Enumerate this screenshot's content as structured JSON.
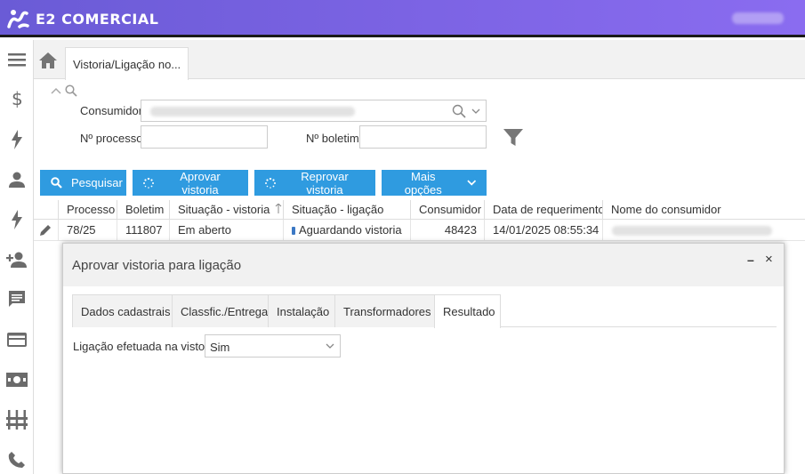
{
  "app": {
    "brand": "E2 COMERCIAL",
    "accent": "#7b63e3"
  },
  "sidebar": {
    "icons": [
      "menu-icon",
      "dollar-icon",
      "bolt-icon",
      "person-icon",
      "bolt-icon-2",
      "person-add-icon",
      "comment-icon",
      "card-icon",
      "money-icon",
      "meter-icon",
      "phone-icon"
    ]
  },
  "tabs": {
    "active": "Vistoria/Ligação no..."
  },
  "filters": {
    "consumidor_label": "Consumidor",
    "processo_label": "Nº processo",
    "boletim_label": "Nº boletim"
  },
  "toolbar": {
    "pesquisar": "Pesquisar",
    "aprovar": "Aprovar vistoria",
    "reprovar": "Reprovar vistoria",
    "mais": "Mais opções"
  },
  "grid": {
    "columns": [
      "Processo",
      "Boletim",
      "Situação - vistoria",
      "Situação - ligação",
      "Consumidor",
      "Data de requerimento",
      "Nome do consumidor"
    ],
    "rows": [
      {
        "processo": "78/25",
        "boletim": "111807",
        "sit_vistoria": "Em aberto",
        "sit_ligacao": "Aguardando vistoria",
        "consumidor": "48423",
        "data": "14/01/2025 08:55:34"
      }
    ]
  },
  "modal": {
    "title": "Aprovar vistoria para ligação",
    "minimize": "–",
    "close": "×",
    "tabs": [
      "Dados cadastrais",
      "Classfic./Entrega",
      "Instalação",
      "Transformadores",
      "Resultado"
    ],
    "active_tab": "Resultado",
    "field_label": "Ligação efetuada na vistoria",
    "field_value": "Sim"
  }
}
